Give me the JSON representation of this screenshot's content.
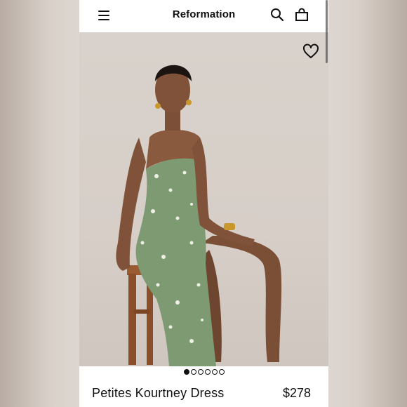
{
  "header": {
    "brand": "Reformation",
    "icons": [
      "menu-icon",
      "search-icon",
      "bag-icon"
    ]
  },
  "gallery": {
    "favorite_icon": "heart-icon",
    "image_count": 6,
    "active_index": 0
  },
  "product": {
    "name": "Petites Kourtney Dress",
    "price": "$278"
  },
  "colors": {
    "dress": "#7d9a72",
    "background": "#d9d2cc",
    "text": "#111111"
  }
}
